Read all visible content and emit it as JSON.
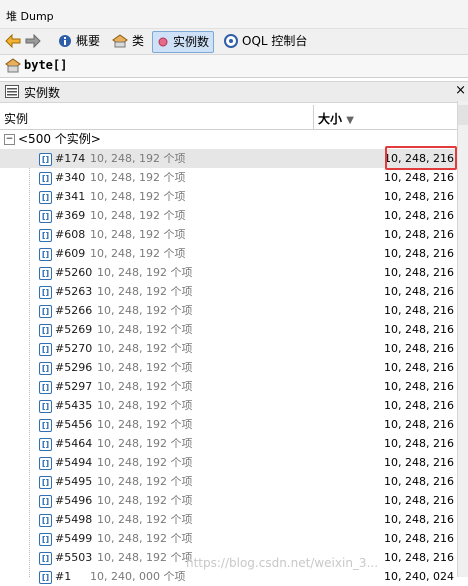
{
  "title": "堆 Dump",
  "toolbar": {
    "back": "back",
    "forward": "forward",
    "summary": "概要",
    "classes": "类",
    "instances": "实例数",
    "oql": "OQL 控制台"
  },
  "class_name": "byte[]",
  "panel_title": "实例数",
  "table": {
    "col_instance": "实例",
    "col_size": "大小",
    "root_label": "<500 个实例>",
    "rows": [
      {
        "id": "#174",
        "count": "10, 248, 192 个项",
        "size": "10, 248, 216"
      },
      {
        "id": "#340",
        "count": "10, 248, 192 个项",
        "size": "10, 248, 216"
      },
      {
        "id": "#341",
        "count": "10, 248, 192 个项",
        "size": "10, 248, 216"
      },
      {
        "id": "#369",
        "count": "10, 248, 192 个项",
        "size": "10, 248, 216"
      },
      {
        "id": "#608",
        "count": "10, 248, 192 个项",
        "size": "10, 248, 216"
      },
      {
        "id": "#609",
        "count": "10, 248, 192 个项",
        "size": "10, 248, 216"
      },
      {
        "id": "#5260",
        "count": "10, 248, 192 个项",
        "size": "10, 248, 216"
      },
      {
        "id": "#5263",
        "count": "10, 248, 192 个项",
        "size": "10, 248, 216"
      },
      {
        "id": "#5266",
        "count": "10, 248, 192 个项",
        "size": "10, 248, 216"
      },
      {
        "id": "#5269",
        "count": "10, 248, 192 个项",
        "size": "10, 248, 216"
      },
      {
        "id": "#5270",
        "count": "10, 248, 192 个项",
        "size": "10, 248, 216"
      },
      {
        "id": "#5296",
        "count": "10, 248, 192 个项",
        "size": "10, 248, 216"
      },
      {
        "id": "#5297",
        "count": "10, 248, 192 个项",
        "size": "10, 248, 216"
      },
      {
        "id": "#5435",
        "count": "10, 248, 192 个项",
        "size": "10, 248, 216"
      },
      {
        "id": "#5456",
        "count": "10, 248, 192 个项",
        "size": "10, 248, 216"
      },
      {
        "id": "#5464",
        "count": "10, 248, 192 个项",
        "size": "10, 248, 216"
      },
      {
        "id": "#5494",
        "count": "10, 248, 192 个项",
        "size": "10, 248, 216"
      },
      {
        "id": "#5495",
        "count": "10, 248, 192 个项",
        "size": "10, 248, 216"
      },
      {
        "id": "#5496",
        "count": "10, 248, 192 个项",
        "size": "10, 248, 216"
      },
      {
        "id": "#5498",
        "count": "10, 248, 192 个项",
        "size": "10, 248, 216"
      },
      {
        "id": "#5499",
        "count": "10, 248, 192 个项",
        "size": "10, 248, 216"
      },
      {
        "id": "#5503",
        "count": "10, 248, 192 个项",
        "size": "10, 248, 216"
      },
      {
        "id": "#1",
        "count": "10, 240, 000 个项",
        "size": "10, 240, 024"
      }
    ]
  },
  "watermark": "https://blog.csdn.net/weixin_3...",
  "colors": {
    "highlight": "#e23b3b",
    "selected_row": "#e6e6e6",
    "active_tab": "#cfe1f7"
  }
}
